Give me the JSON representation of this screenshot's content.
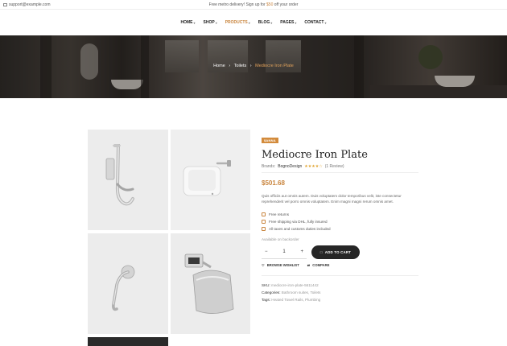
{
  "topbar": {
    "email": "support@example.com",
    "promo_prefix": "Free metro delivery! Sign up for",
    "promo_amount": "$50",
    "promo_suffix": "off your order"
  },
  "nav": {
    "items": [
      {
        "label": "HOME",
        "has_dropdown": true
      },
      {
        "label": "SHOP",
        "has_dropdown": true
      },
      {
        "label": "PRODUCTS",
        "has_dropdown": true,
        "active": true
      },
      {
        "label": "BLOG",
        "has_dropdown": true
      },
      {
        "label": "PAGES",
        "has_dropdown": true
      },
      {
        "label": "CONTACT",
        "has_dropdown": true
      }
    ]
  },
  "breadcrumb": {
    "items": [
      "Home",
      "Toilets",
      "Mediocre Iron Plate"
    ]
  },
  "product": {
    "badge": "$ANNA",
    "title": "Mediocre Iron Plate",
    "brand_label": "Brands:",
    "brand": "BognoDesign",
    "rating": 4,
    "reviews": "(1 Review)",
    "price": "$501.68",
    "description": "Quis officiis aut omnis autem. Duis voluptatem dolor temporibus velit, iste consectetur reprehenderit vel porro omnis voluptatem. Enim magni magni rerum omnis amet.",
    "features": [
      "Free returns",
      "Free shipping via DHL, fully insured",
      "All taxes and customs duties included"
    ],
    "availability": "Available on backorder",
    "quantity": "1",
    "add_to_cart": "ADD TO CART",
    "wishlist": "BROWSE WISHLIST",
    "compare": "COMPARE",
    "sku_label": "SKU:",
    "sku": "mediocre-iron-plate-5611442",
    "categories_label": "Categories:",
    "categories": "Bathroom suites, Toilets",
    "tags_label": "Tags:",
    "tags": "Heated Towel Rails, Plumbing"
  },
  "colors": {
    "accent": "#c9853e",
    "dark_button": "#262626"
  }
}
